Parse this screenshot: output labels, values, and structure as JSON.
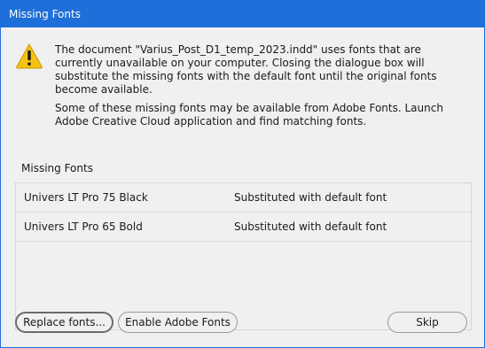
{
  "window": {
    "title": "Missing Fonts"
  },
  "message": {
    "icon": "warning-icon",
    "line1": "The document \"Varius_Post_D1_temp_2023.indd\" uses fonts that are currently unavailable on your computer. Closing the dialogue box will substitute the missing fonts with the default font until the original fonts become available.",
    "line2": "Some of these missing fonts may be available from Adobe Fonts. Launch Adobe Creative Cloud application and find matching fonts."
  },
  "missing_fonts": {
    "label": "Missing Fonts",
    "rows": [
      {
        "font": "Univers LT Pro 75 Black",
        "status": "Substituted with default font"
      },
      {
        "font": "Univers LT Pro 65 Bold",
        "status": "Substituted with default font"
      }
    ]
  },
  "buttons": {
    "replace": "Replace fonts...",
    "enable_adobe": "Enable Adobe Fonts",
    "skip": "Skip"
  },
  "colors": {
    "titlebar": "#1e6fd9",
    "warning_fill": "#f5c211",
    "dialog_bg": "#f0f0f0"
  }
}
